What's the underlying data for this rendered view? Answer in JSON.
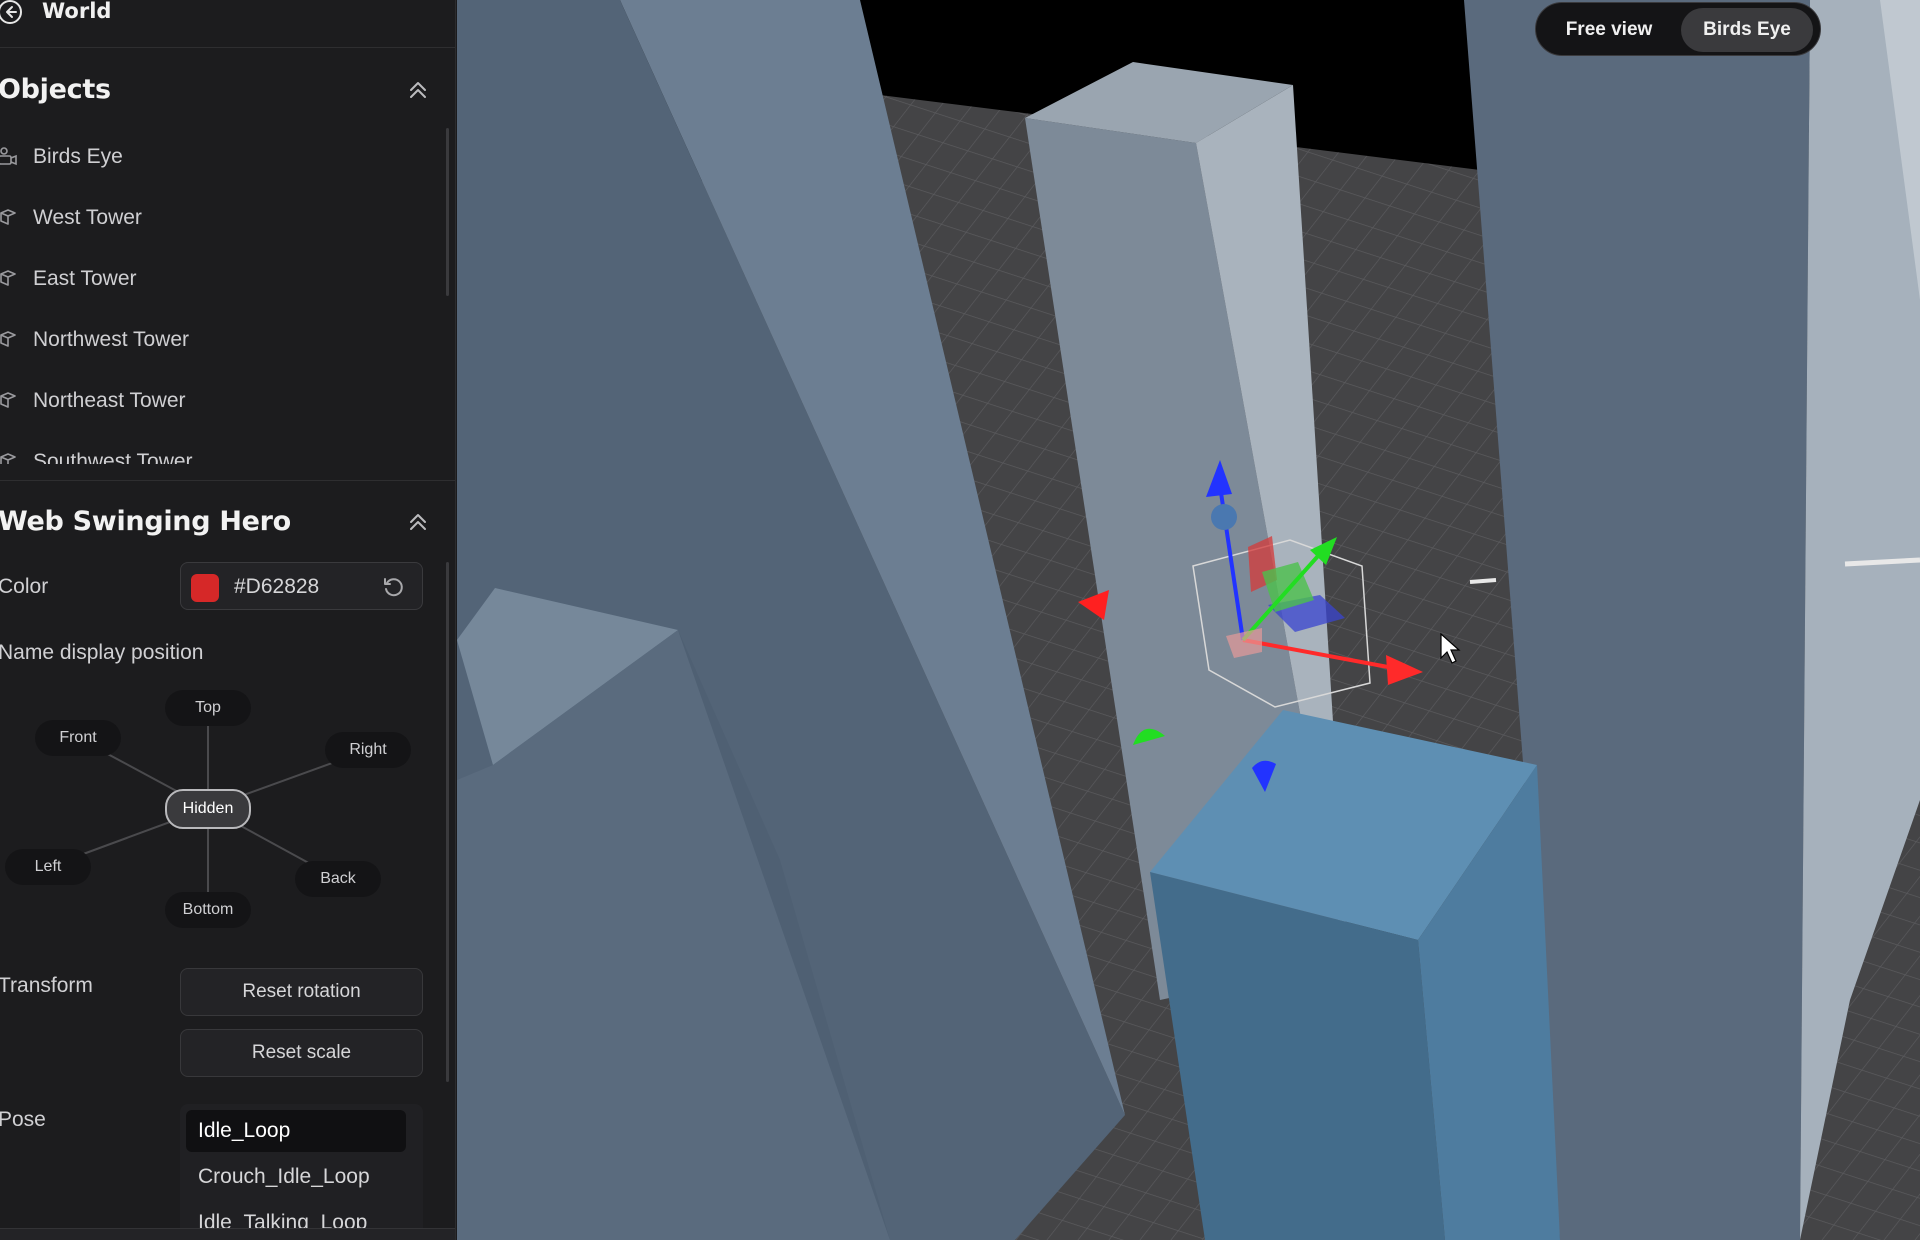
{
  "header": {
    "title": "World"
  },
  "objects": {
    "title": "Objects",
    "items": [
      {
        "label": "Birds Eye",
        "icon": "camera-icon"
      },
      {
        "label": "West Tower",
        "icon": "cube-icon"
      },
      {
        "label": "East Tower",
        "icon": "cube-icon"
      },
      {
        "label": "Northwest Tower",
        "icon": "cube-icon"
      },
      {
        "label": "Northeast Tower",
        "icon": "cube-icon"
      },
      {
        "label": "Southwest Tower",
        "icon": "cube-icon"
      }
    ]
  },
  "inspector": {
    "title": "Web Swinging Hero",
    "color": {
      "label": "Color",
      "value": "#D62828"
    },
    "name_position": {
      "label": "Name display position",
      "options": [
        "Top",
        "Front",
        "Right",
        "Hidden",
        "Left",
        "Back",
        "Bottom"
      ],
      "selected": "Hidden"
    },
    "transform": {
      "label": "Transform",
      "reset_rotation": "Reset rotation",
      "reset_scale": "Reset scale"
    },
    "pose": {
      "label": "Pose",
      "options": [
        "Idle_Loop",
        "Crouch_Idle_Loop",
        "Idle_Talking_Loop"
      ],
      "selected": "Idle_Loop"
    }
  },
  "view_toggle": {
    "options": [
      "Free view",
      "Birds Eye"
    ],
    "selected": "Birds Eye"
  },
  "colors": {
    "panel_bg": "#1c1c1e",
    "accent_hero": "#D62828",
    "gizmo_x": "#ff2a2a",
    "gizmo_y": "#22dd22",
    "gizmo_z": "#2233ff",
    "tower_highlight": "#5e8fb3"
  }
}
